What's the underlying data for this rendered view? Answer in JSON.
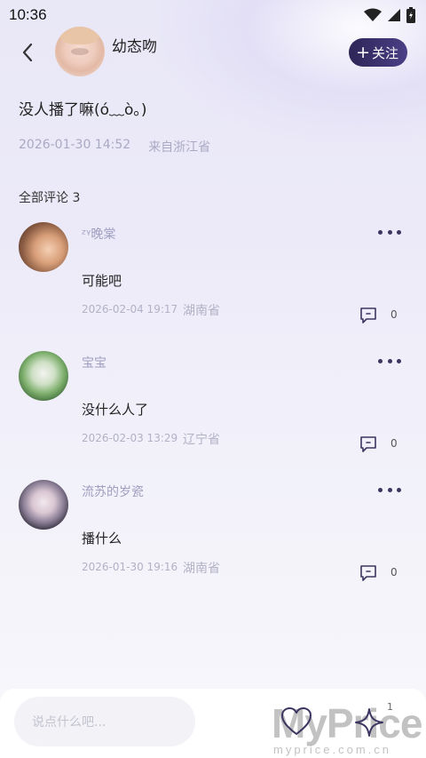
{
  "status_bar": {
    "time": "10:36"
  },
  "header": {
    "author": "幼态吻",
    "follow_label": "关注"
  },
  "post": {
    "text": "没人播了嘛(ó﹏ò｡)",
    "date": "2026-01-30 14:52",
    "location": "来自浙江省"
  },
  "comments_title": "全部评论 3",
  "comments": [
    {
      "name": "ᶻᵞ晚棠",
      "text": "可能吧",
      "date": "2026-02-04 19:17",
      "province": "湖南省",
      "reply_count": "0"
    },
    {
      "name": "宝宝",
      "text": "没什么人了",
      "date": "2026-02-03 13:29",
      "province": "辽宁省",
      "reply_count": "0"
    },
    {
      "name": "流苏的岁瓷",
      "text": "播什么",
      "date": "2026-01-30 19:16",
      "province": "湖南省",
      "reply_count": "0"
    }
  ],
  "bottom_bar": {
    "input_placeholder": "说点什么吧...",
    "star_count": "1"
  },
  "watermark": {
    "text": "MyPrice",
    "sub": "myprice.com.cn"
  },
  "colors": {
    "accent": "#2d2657",
    "meta": "#aaa9c4",
    "name": "#9f9ec0"
  },
  "icons": [
    "back-arrow-icon",
    "wifi-icon",
    "signal-icon",
    "battery-icon",
    "more-icon",
    "reply-icon",
    "heart-icon",
    "sparkle-icon"
  ]
}
